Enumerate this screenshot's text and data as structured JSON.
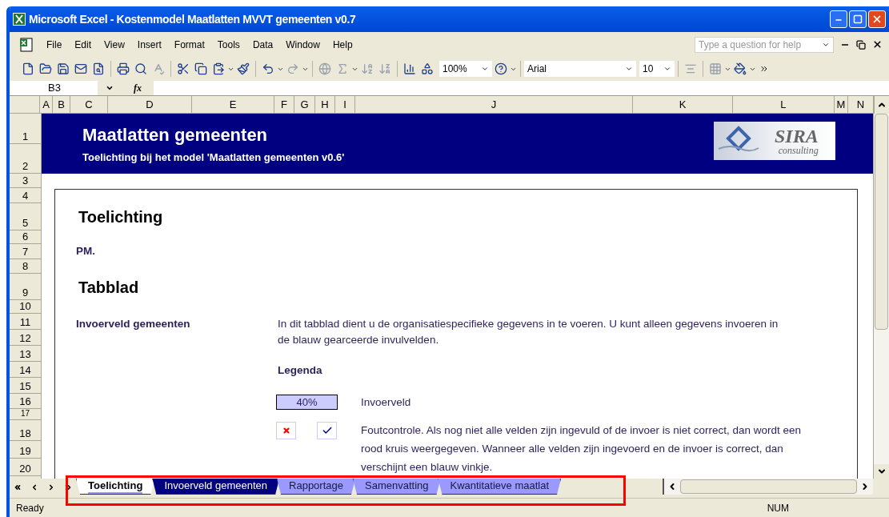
{
  "window": {
    "title": "Microsoft Excel - Kostenmodel Maatlatten MVVT gemeenten v0.7"
  },
  "menu": [
    "File",
    "Edit",
    "View",
    "Insert",
    "Format",
    "Tools",
    "Data",
    "Window",
    "Help"
  ],
  "help_box": {
    "placeholder": "Type a question for help"
  },
  "toolbar": {
    "zoom": "100%",
    "font": "Arial",
    "font_size": "10"
  },
  "formula_bar": {
    "name_box": "B3",
    "function_label": "fx"
  },
  "columns": [
    "A",
    "B",
    "C",
    "D",
    "E",
    "F",
    "G",
    "H",
    "I",
    "J",
    "K",
    "L",
    "M",
    "N"
  ],
  "rows": [
    "1",
    "2",
    "3",
    "4",
    "5",
    "6",
    "7",
    "8",
    "9",
    "10",
    "11",
    "12",
    "13",
    "14",
    "15",
    "16",
    "17",
    "18",
    "19",
    "20"
  ],
  "banner": {
    "title": "Maatlatten gemeenten",
    "subtitle": "Toelichting bij het model 'Maatlatten gemeenten v0.6'",
    "logo_name": "SIRA",
    "logo_tagline": "consulting"
  },
  "content": {
    "heading_1": "Toelichting",
    "note": "PM.",
    "heading_2": "Tabblad",
    "section_label": "Invoerveld gemeenten",
    "section_text": "In dit tabblad dient u de organisatiespecifieke gegevens in te voeren. U kunt alleen gegevens invoeren in de blauw gearceerde invulvelden.",
    "legend_title": "Legenda",
    "legend": [
      {
        "kind": "input",
        "sample": "40%",
        "text": "Invoerveld"
      },
      {
        "kind": "check",
        "text": "Foutcontrole. Als nog niet alle velden zijn ingevuld of de invoer is niet correct, dan wordt een rood kruis weergegeven. Wanneer alle velden zijn ingevoerd en de invoer is correct, dan verschijnt een blauw vinkje."
      }
    ]
  },
  "sheet_tabs": [
    {
      "label": "Toelichting",
      "selected": true,
      "color": "#9999ff"
    },
    {
      "label": "Invoerveld gemeenten",
      "selected": false,
      "color": "#000080"
    },
    {
      "label": "Rapportage",
      "selected": false,
      "color": "#9999ff"
    },
    {
      "label": "Samenvatting",
      "selected": false,
      "color": "#9999ff"
    },
    {
      "label": "Kwantitatieve maatlat",
      "selected": false,
      "color": "#9999ff"
    }
  ],
  "status_bar": {
    "mode": "Ready",
    "indicator": "NUM"
  }
}
